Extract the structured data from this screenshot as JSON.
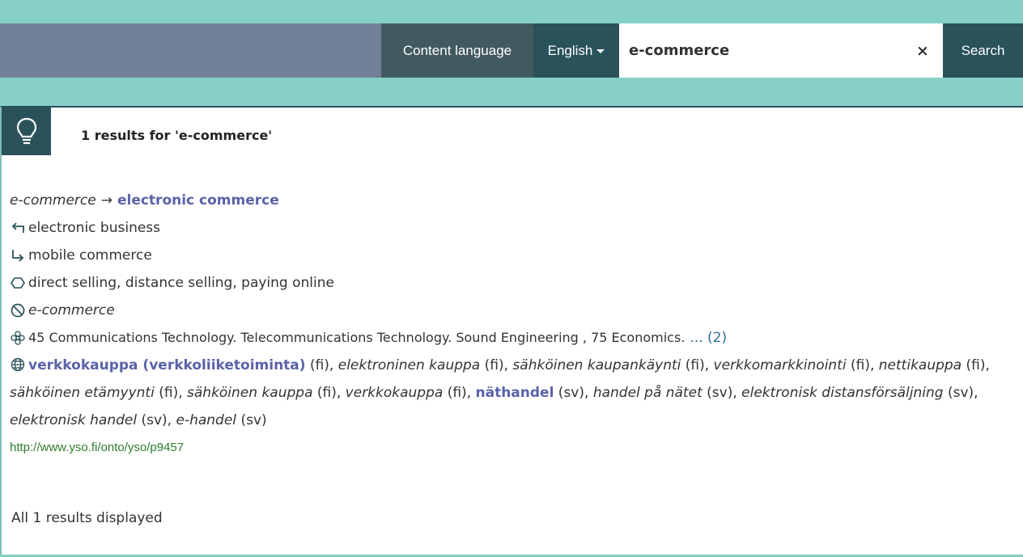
{
  "header": {
    "content_language_label": "Content language",
    "language_selected": "English",
    "search_value": "e-commerce",
    "clear_symbol": "×",
    "search_button": "Search"
  },
  "results": {
    "count_text": "1 results for 'e-commerce'",
    "alt_label": "e-commerce",
    "arrow": "→",
    "pref_label": "electronic commerce",
    "broader": "electronic business",
    "narrower": "mobile commerce",
    "related": "direct selling, distance selling, paying online",
    "hidden": "e-commerce",
    "groups": "45 Communications Technology. Telecommunications Technology. Sound Engineering , 75 Economics.",
    "groups_more": "... (2)",
    "translations": [
      {
        "term": "verkkokauppa (verkkoliiketoiminta)",
        "lang": "(fi),",
        "style": "pref"
      },
      {
        "term": "elektroninen kauppa",
        "lang": "(fi),",
        "style": "italic"
      },
      {
        "term": "sähköinen kaupankäynti",
        "lang": "(fi),",
        "style": "italic"
      },
      {
        "term": "verkkomarkkinointi",
        "lang": "(fi),",
        "style": "italic"
      },
      {
        "term": "nettikauppa",
        "lang": "(fi),",
        "style": "italic"
      },
      {
        "term": "sähköinen etämyynti",
        "lang": "(fi),",
        "style": "italic"
      },
      {
        "term": "sähköinen kauppa",
        "lang": "(fi),",
        "style": "italic"
      },
      {
        "term": "verkkokauppa",
        "lang": "(fi),",
        "style": "italic"
      },
      {
        "term": "näthandel",
        "lang": "(sv),",
        "style": "pref"
      },
      {
        "term": "handel på nätet",
        "lang": "(sv),",
        "style": "italic"
      },
      {
        "term": "elektronisk distansförsäljning",
        "lang": "(sv),",
        "style": "italic"
      },
      {
        "term": "elektronisk handel",
        "lang": "(sv),",
        "style": "italic"
      },
      {
        "term": "e-handel",
        "lang": "(sv)",
        "style": "italic"
      }
    ],
    "uri": "http://www.yso.fi/onto/yso/p9457",
    "footer": "All 1 results displayed"
  },
  "icons": {
    "bulb": "lightbulb-icon",
    "broader": "broader-arrow-icon",
    "narrower": "narrower-arrow-icon",
    "related": "related-icon",
    "hidden": "hidden-label-icon",
    "groups": "groups-icon",
    "translations": "globe-icon"
  },
  "colors": {
    "teal_bg": "#86d0c8",
    "navbar": "#717f99",
    "dark_teal": "#29525b",
    "pref_label": "#5a62a8",
    "uri": "#2e7d2e"
  }
}
